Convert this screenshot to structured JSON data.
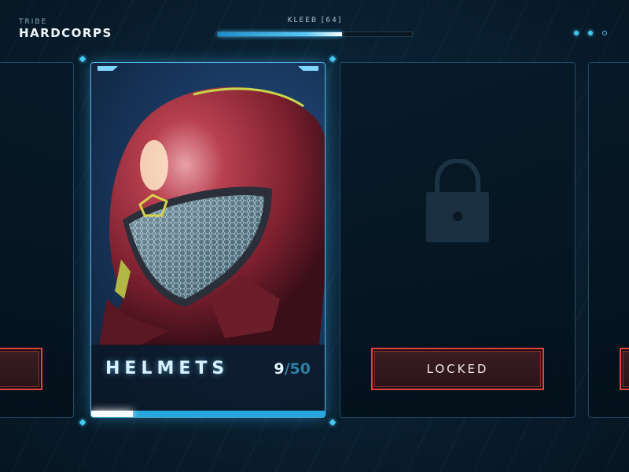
{
  "header": {
    "eyebrow": "TRIBE",
    "title": "HARDCORPS",
    "player_label": "KLEEB [64]",
    "xp_progress": 0.64
  },
  "pager": {
    "total": 3,
    "current": 2
  },
  "cards": [
    {
      "name": "HELMETS",
      "count_current": "9",
      "count_separator": "/",
      "count_max": "50",
      "progress": 0.18,
      "art": "red-armored-helmet"
    },
    {
      "state_label": "LOCKED",
      "icon": "padlock-icon"
    }
  ],
  "colors": {
    "accent": "#46c9f2",
    "locked_border": "#e2433d",
    "background": "#0a2133"
  }
}
